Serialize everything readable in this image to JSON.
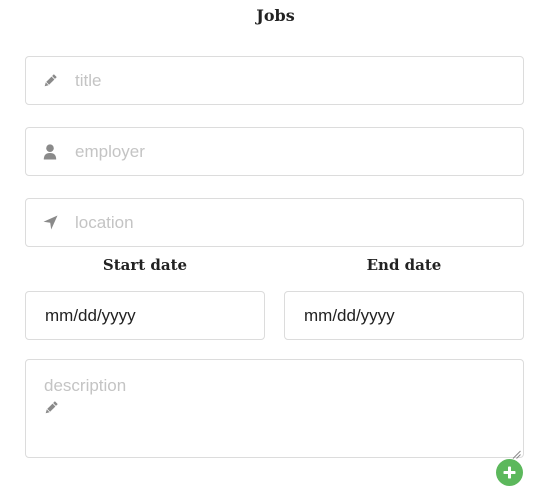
{
  "section": {
    "title": "Jobs"
  },
  "fields": {
    "title": {
      "placeholder": "title",
      "value": "",
      "icon": "pencil-icon"
    },
    "employer": {
      "placeholder": "employer",
      "value": "",
      "icon": "user-icon"
    },
    "location": {
      "placeholder": "location",
      "value": "",
      "icon": "location-arrow-icon"
    }
  },
  "dates": {
    "start_label": "Start date",
    "start_value": "mm/dd/yyyy",
    "end_label": "End date",
    "end_value": "mm/dd/yyyy"
  },
  "description": {
    "placeholder": "description",
    "icon": "pencil-icon"
  },
  "actions": {
    "add_icon": "plus-circle-icon"
  },
  "colors": {
    "icon_gray": "#8a8a8a",
    "placeholder_gray": "#c4c4c4",
    "border": "#dcdcdc",
    "add_green": "#5cb85c"
  }
}
